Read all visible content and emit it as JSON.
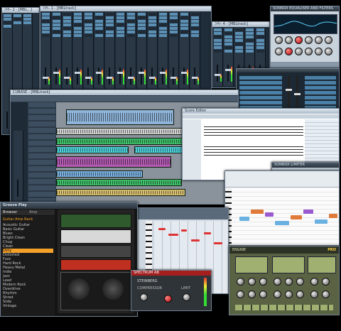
{
  "windows": {
    "mixer_small_title": "ﾐｷｻｰ 2 - [MBL...]",
    "mixer_main_title": "ﾐｷｻｰ 1 - [MBLtrack]",
    "mixer_right_title": "ﾐｷｻｰ 4 - [MBLtrack]",
    "eq_title": "SONNOX EQUALISER AND FILTERS",
    "project_title": "CUBASE - [MBLtrack]",
    "score_title": "Score Editor",
    "limiter_title": "SONNOX LIMITER",
    "groove_agent_title": "Groove Play",
    "groove_tab_browser": "Browser",
    "groove_tab_amp": "Amp",
    "groove_list_heading": "Guitar Amp Rack",
    "groove_list_items": [
      "Acoustic Guitar",
      "Basic Guitar",
      "Blues",
      "Bright Clean",
      "Chug",
      "Clean",
      "Dirty",
      "Distorted",
      "Fuzz",
      "Hard Rock",
      "Heavy Metal",
      "Indie",
      "Jazz",
      "Lead",
      "Modern Rock",
      "Overdrive",
      "Rhythm",
      "Shred",
      "Slide",
      "Vintage"
    ],
    "fx_box_title": "SPECTRUM AB",
    "fx_box_brand": "STEINBERG",
    "fx_box_label_left": "COMPRESSOR",
    "fx_box_label_right": "LIMIT",
    "synth_title": "ENGINE",
    "pro_badge": "PRO"
  },
  "colors": {
    "background": "#000000",
    "mixer_body": "#2a3846",
    "slot_blue": "#5b8fb4",
    "wave_green": "#3fbf6a",
    "wave_blue": "#7ab0e0",
    "wave_purple": "#b15ab0",
    "wave_cyan": "#4dd0d8",
    "amp_red": "#c03020",
    "synth_olive": "#8c9a5a"
  },
  "icons": [
    "mixer-fader-icon",
    "knob-icon",
    "meter-icon",
    "piano-keys-icon",
    "amp-head-icon",
    "speaker-cabinet-icon"
  ]
}
